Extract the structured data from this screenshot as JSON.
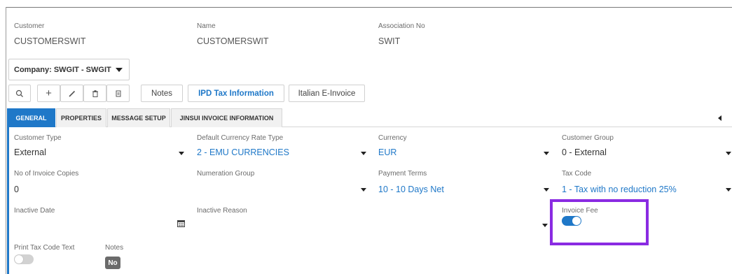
{
  "header": {
    "fields": [
      {
        "label": "Customer",
        "value": "CUSTOMERSWIT"
      },
      {
        "label": "Name",
        "value": "CUSTOMERSWIT"
      },
      {
        "label": "Association No",
        "value": "SWIT"
      }
    ]
  },
  "company_selector": {
    "label": "Company: SWGIT - SWGIT"
  },
  "toolbar": {
    "icons": [
      "search-icon",
      "add-icon",
      "edit-icon",
      "delete-icon",
      "duplicate-icon"
    ],
    "notes_label": "Notes",
    "ipd_tax_label": "IPD Tax Information",
    "italian_einvoice_label": "Italian E-Invoice"
  },
  "tabs": [
    "GENERAL",
    "PROPERTIES",
    "MESSAGE SETUP",
    "JINSUI INVOICE INFORMATION"
  ],
  "active_tab": "GENERAL",
  "form": {
    "customer_type": {
      "label": "Customer Type",
      "value": "External"
    },
    "default_currency_rate_type": {
      "label": "Default Currency Rate Type",
      "value": "2 - EMU CURRENCIES"
    },
    "currency": {
      "label": "Currency",
      "value": "EUR"
    },
    "customer_group": {
      "label": "Customer Group",
      "value": "0 - External"
    },
    "no_of_invoice_copies": {
      "label": "No of Invoice Copies",
      "value": "0"
    },
    "numeration_group": {
      "label": "Numeration Group",
      "value": ""
    },
    "payment_terms": {
      "label": "Payment Terms",
      "value": "10 - 10 Days Net"
    },
    "tax_code": {
      "label": "Tax Code",
      "value": "1 - Tax with no reduction 25%"
    },
    "inactive_date": {
      "label": "Inactive Date",
      "value": ""
    },
    "inactive_reason": {
      "label": "Inactive Reason",
      "value": ""
    },
    "invoice_fee": {
      "label": "Invoice Fee",
      "enabled": true
    },
    "print_tax_code_text": {
      "label": "Print Tax Code Text",
      "enabled": false
    },
    "notes": {
      "label": "Notes",
      "value": "No"
    }
  },
  "colors": {
    "accent": "#1f78c8",
    "highlight": "#8a2be2"
  }
}
